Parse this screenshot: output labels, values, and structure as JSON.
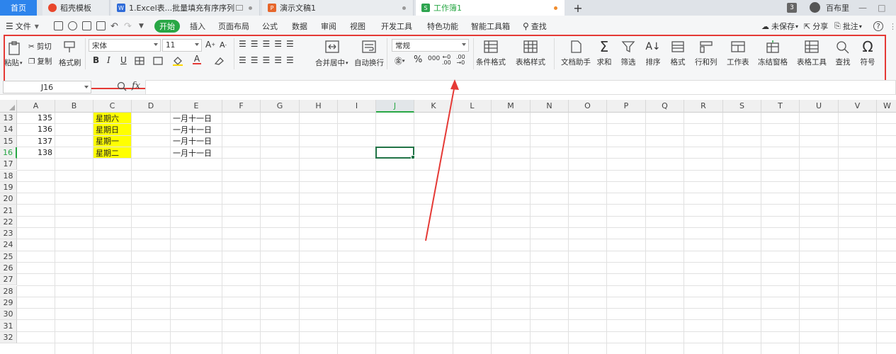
{
  "tabs": {
    "home": "首页",
    "t1": "稻壳模板",
    "t2": "1.Excel表...批量填充有序序列",
    "t3": "演示文稿1",
    "t4": "工作簿1",
    "new_tab": "+"
  },
  "user": {
    "badge": "3",
    "name": "百布里"
  },
  "menu": {
    "file": "文件",
    "items": [
      "开始",
      "插入",
      "页面布局",
      "公式",
      "数据",
      "审阅",
      "视图",
      "开发工具",
      "特色功能",
      "智能工具箱"
    ],
    "search": "查找",
    "unsaved": "未保存",
    "share": "分享",
    "comment": "批注"
  },
  "ribbon": {
    "paste": "粘贴",
    "cut": "剪切",
    "copy": "复制",
    "format_painter": "格式刷",
    "font_name": "宋体",
    "font_size": "11",
    "bold": "B",
    "italic": "I",
    "underline": "U",
    "merge_center": "合并居中",
    "wrap_text": "自动换行",
    "number_format": "常规",
    "percent": "%",
    "thousands": "000",
    "cond_format": "条件格式",
    "table_style": "表格样式",
    "doc_assistant": "文档助手",
    "sum": "求和",
    "filter": "筛选",
    "sort": "排序",
    "format": "格式",
    "row_col": "行和列",
    "worksheet": "工作表",
    "freeze": "冻结窗格",
    "table_tools": "表格工具",
    "find": "查找",
    "symbol": "符号"
  },
  "formula_bar": {
    "name_box": "J16",
    "fx": "fx",
    "value": ""
  },
  "columns": [
    "A",
    "B",
    "C",
    "D",
    "E",
    "F",
    "G",
    "H",
    "I",
    "J",
    "K",
    "L",
    "M",
    "N",
    "O",
    "P",
    "Q",
    "R",
    "S",
    "T",
    "U",
    "V",
    "W"
  ],
  "active_column": "J",
  "rows": [
    "13",
    "14",
    "15",
    "16",
    "17",
    "18",
    "19",
    "20",
    "21",
    "22",
    "23",
    "24",
    "25",
    "26",
    "27",
    "28",
    "29",
    "30",
    "31",
    "32"
  ],
  "active_row": "16",
  "cells": [
    {
      "a": "135",
      "c": "星期六",
      "e": "一月十一日"
    },
    {
      "a": "136",
      "c": "星期日",
      "e": "一月十一日"
    },
    {
      "a": "137",
      "c": "星期一",
      "e": "一月十一日"
    },
    {
      "a": "138",
      "c": "星期二",
      "e": "一月十一日"
    }
  ],
  "colors": {
    "accent": "#28a745",
    "highlight": "#ffff00",
    "annotation": "#e53935"
  }
}
